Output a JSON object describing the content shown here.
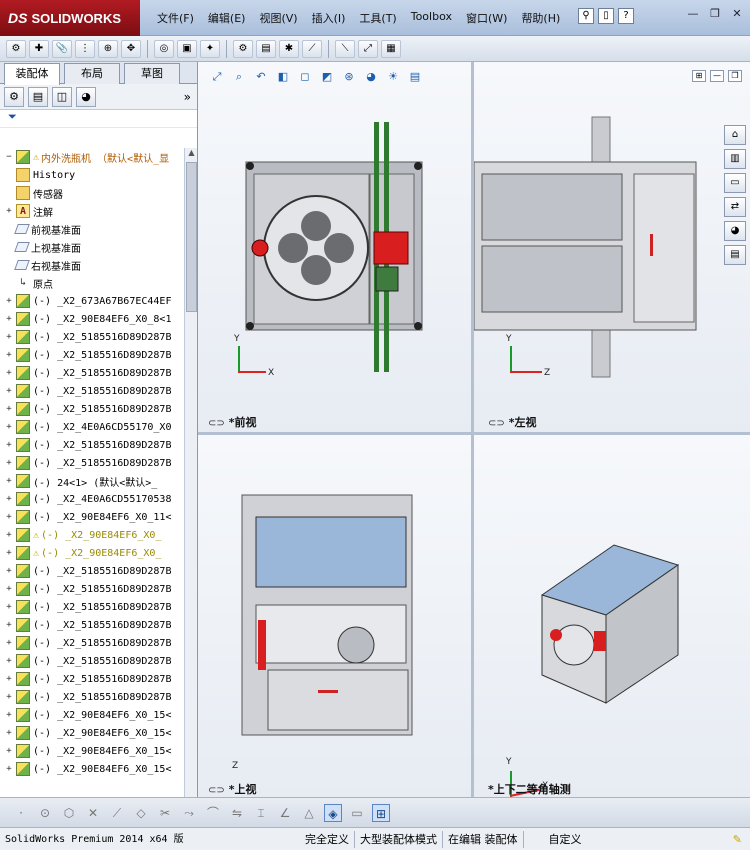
{
  "app": {
    "brand": "SOLIDWORKS",
    "brand_prefix": "DS",
    "menus": [
      "文件(F)",
      "编辑(E)",
      "视图(V)",
      "插入(I)",
      "工具(T)",
      "Toolbox",
      "窗口(W)",
      "帮助(H)"
    ]
  },
  "feature_manager": {
    "tabs": [
      "装配体",
      "布局",
      "草图"
    ],
    "active_tab": "装配体",
    "filter_icon": "funnel-icon",
    "root": "内外洗瓶机  （默认<默认_显",
    "fixed_items": [
      {
        "label": "History",
        "icon": "history-icon"
      },
      {
        "label": "传感器",
        "icon": "sensor-icon"
      },
      {
        "label": "注解",
        "icon": "annotation-icon"
      },
      {
        "label": "前视基准面",
        "icon": "plane-icon"
      },
      {
        "label": "上视基准面",
        "icon": "plane-icon"
      },
      {
        "label": "右视基准面",
        "icon": "plane-icon"
      },
      {
        "label": "原点",
        "icon": "origin-icon"
      }
    ],
    "components": [
      {
        "label": "(-) _X2_673A67B67EC44EF",
        "warn": false
      },
      {
        "label": "(-) _X2_90E84EF6_X0_8<1",
        "warn": false
      },
      {
        "label": "(-) _X2_5185516D89D287B",
        "warn": false
      },
      {
        "label": "(-) _X2_5185516D89D287B",
        "warn": false
      },
      {
        "label": "(-) _X2_5185516D89D287B",
        "warn": false
      },
      {
        "label": "(-) _X2_5185516D89D287B",
        "warn": false
      },
      {
        "label": "(-) _X2_5185516D89D287B",
        "warn": false
      },
      {
        "label": "(-) _X2_4E0A6CD55170_X0",
        "warn": false
      },
      {
        "label": "(-) _X2_5185516D89D287B",
        "warn": false
      },
      {
        "label": "(-) _X2_5185516D89D287B",
        "warn": false
      },
      {
        "label": "(-) 24<1> (默认<默认>_",
        "warn": false
      },
      {
        "label": "(-) _X2_4E0A6CD55170538",
        "warn": false
      },
      {
        "label": "(-) _X2_90E84EF6_X0_11<",
        "warn": false
      },
      {
        "label": "(-) _X2_90E84EF6_X0_",
        "warn": true
      },
      {
        "label": "(-) _X2_90E84EF6_X0_",
        "warn": true
      },
      {
        "label": "(-) _X2_5185516D89D287B",
        "warn": false
      },
      {
        "label": "(-) _X2_5185516D89D287B",
        "warn": false
      },
      {
        "label": "(-) _X2_5185516D89D287B",
        "warn": false
      },
      {
        "label": "(-) _X2_5185516D89D287B",
        "warn": false
      },
      {
        "label": "(-) _X2_5185516D89D287B",
        "warn": false
      },
      {
        "label": "(-) _X2_5185516D89D287B",
        "warn": false
      },
      {
        "label": "(-) _X2_5185516D89D287B",
        "warn": false
      },
      {
        "label": "(-) _X2_5185516D89D287B",
        "warn": false
      },
      {
        "label": "(-) _X2_90E84EF6_X0_15<",
        "warn": false
      },
      {
        "label": "(-) _X2_90E84EF6_X0_15<",
        "warn": false
      },
      {
        "label": "(-) _X2_90E84EF6_X0_15<",
        "warn": false
      },
      {
        "label": "(-) _X2_90E84EF6_X0_15<",
        "warn": false
      }
    ]
  },
  "viewports": {
    "front": "*前视",
    "left": "*左视",
    "top": "*上视",
    "iso": "*上下二等角轴测",
    "axis_x": "X",
    "axis_y": "Y",
    "axis_z": "Z"
  },
  "status_bar": {
    "app_version": "SolidWorks Premium 2014 x64 版",
    "fully_defined": "完全定义",
    "large_assembly": "大型装配体模式",
    "editing": "在编辑 装配体",
    "custom": "自定义"
  },
  "colors": {
    "accent_red": "#b11b22",
    "plane_blue": "#9ab6d8",
    "machine_red": "#d81e1e",
    "machine_green": "#2e7a2e"
  }
}
